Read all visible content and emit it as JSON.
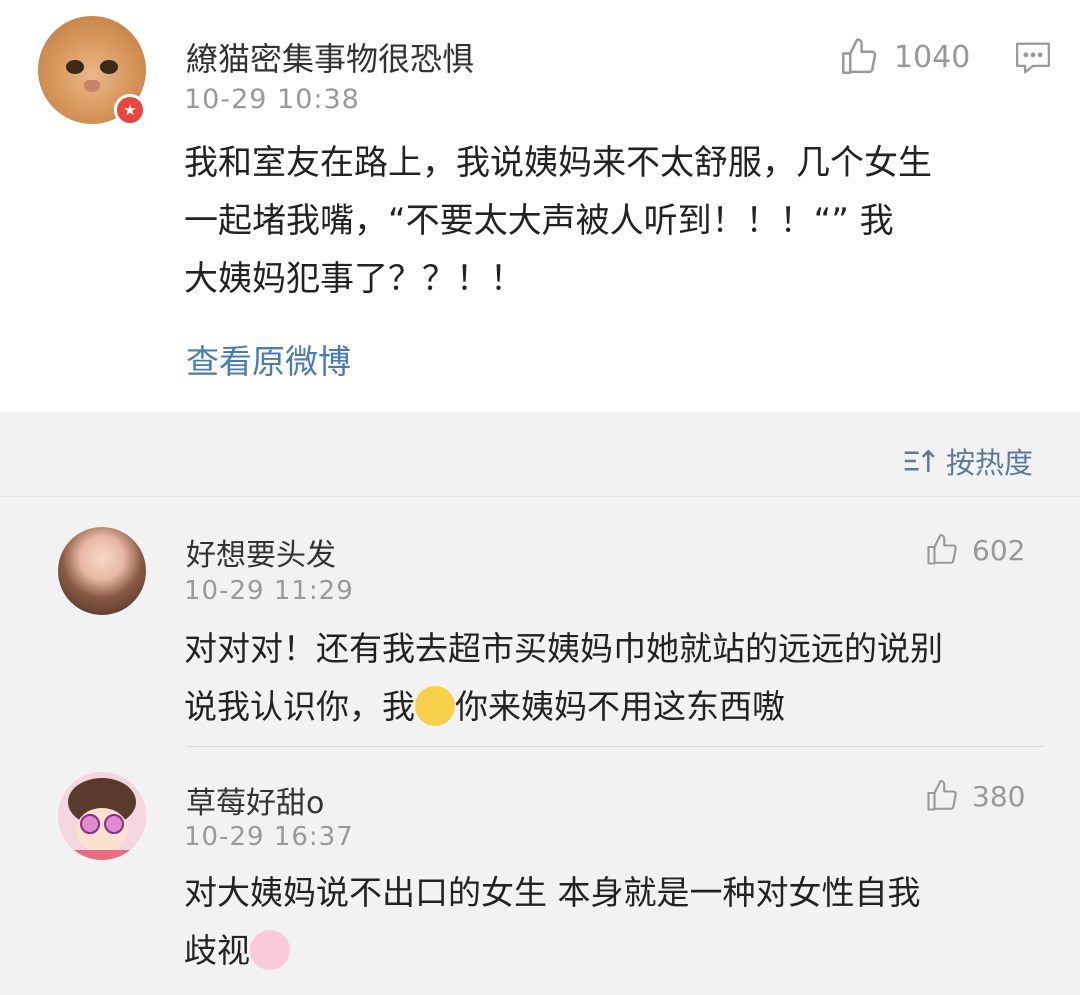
{
  "post": {
    "author": "繚猫密集事物很恐惧",
    "time": "10-29 10:38",
    "like_count": "1040",
    "lines": [
      "我和室友在路上，我说姨妈来不太舒服，几个女生",
      "一起堵我嘴，“不要太大声被人听到！！！“”  我",
      "大姨妈犯事了？？！！"
    ],
    "view_original": "查看原微博"
  },
  "sort": {
    "label": "按热度"
  },
  "comments": [
    {
      "author": "好想要头发",
      "time": "10-29 11:29",
      "like_count": "602",
      "line1": "对对对！还有我去超市买姨妈巾她就站的远远的说别",
      "line2_before": "说我认识你，我",
      "line2_after": "你来姨妈不用这东西嗷"
    },
    {
      "author": "草莓好甜o",
      "time": "10-29 16:37",
      "like_count": "380",
      "line1": "对大姨妈说不出口的女生 本身就是一种对女性自我",
      "line2": "歧视"
    }
  ],
  "colors": {
    "link": "#4a7cb4",
    "muted": "#999999",
    "sort": "#5a7b9c"
  }
}
